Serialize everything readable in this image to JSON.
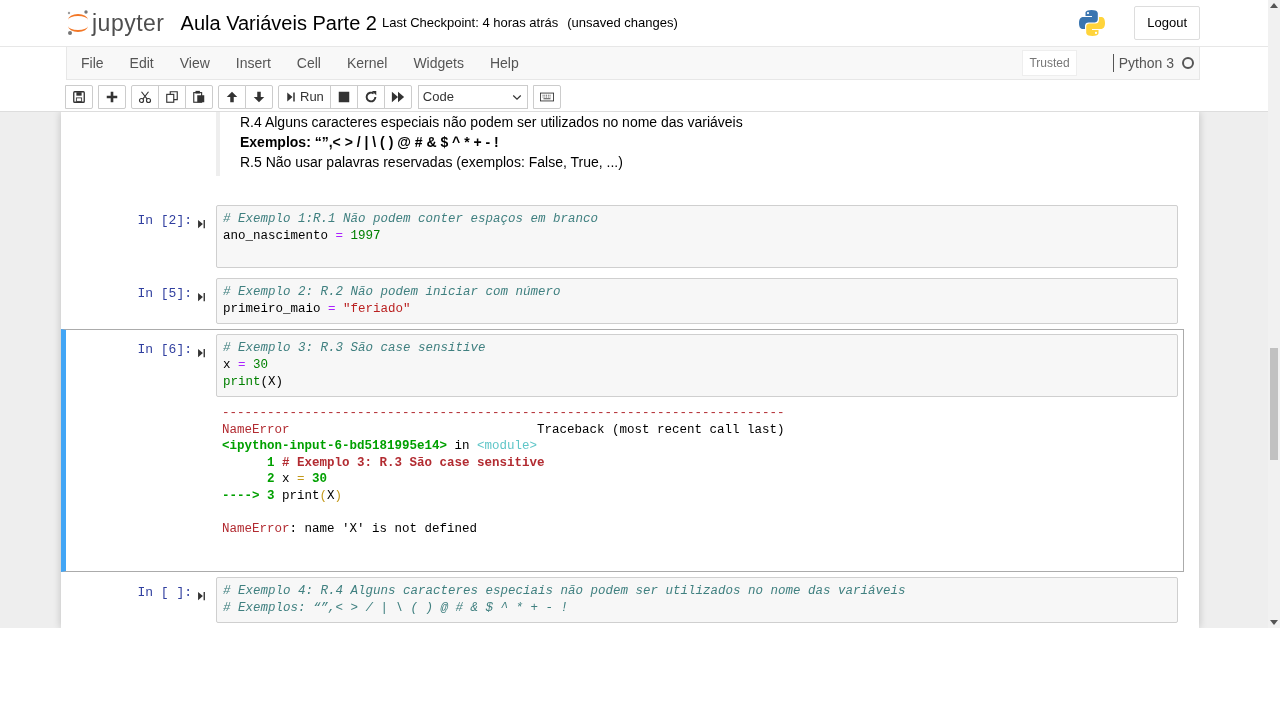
{
  "header": {
    "logo_text": "jupyter",
    "title": "Aula Variáveis Parte 2",
    "checkpoint": "Last Checkpoint: 4 horas atrás",
    "unsaved": "(unsaved changes)",
    "logout": "Logout"
  },
  "menu": [
    "File",
    "Edit",
    "View",
    "Insert",
    "Cell",
    "Kernel",
    "Widgets",
    "Help"
  ],
  "trusted": "Trusted",
  "kernel": {
    "name": "Python 3",
    "idle": true
  },
  "toolbar": [
    [
      {
        "kind": "save"
      }
    ],
    [
      {
        "kind": "add"
      }
    ],
    [
      {
        "kind": "cut"
      },
      {
        "kind": "copy"
      },
      {
        "kind": "paste"
      }
    ],
    [
      {
        "kind": "up"
      },
      {
        "kind": "down"
      }
    ],
    [
      {
        "kind": "run",
        "label": "Run"
      },
      {
        "kind": "stop"
      },
      {
        "kind": "restart"
      },
      {
        "kind": "forward"
      }
    ],
    [
      {
        "kind": "select",
        "value": "Code"
      }
    ],
    [
      {
        "kind": "keyboard"
      }
    ]
  ],
  "cells": [
    {
      "kind": "markdown",
      "lines": [
        {
          "kind": "plain",
          "text": "R.4 Alguns caracteres especiais não podem ser utilizados no nome das variáveis"
        },
        {
          "kind": "bold",
          "text": "Exemplos: “”,< > / | \\ ( ) @ # & $ ^ * + - !"
        },
        {
          "kind": "plain",
          "text": "R.5 Não usar palavras reservadas (exemplos: False, True, ...)"
        }
      ]
    },
    {
      "kind": "code",
      "prompt": "In [2]:",
      "selected": false,
      "input": [
        [
          {
            "kind": "comment",
            "text": "# Exemplo 1:R.1 Não podem conter espaços em branco"
          }
        ],
        [
          {
            "kind": "name",
            "text": "ano_nascimento "
          },
          {
            "kind": "op",
            "text": "="
          },
          {
            "kind": "num",
            "text": " 1997"
          }
        ]
      ]
    },
    {
      "kind": "code",
      "prompt": "In [5]:",
      "selected": false,
      "input": [
        [
          {
            "kind": "comment",
            "text": "# Exemplo 2: R.2 Não podem iniciar com número"
          }
        ],
        [
          {
            "kind": "name",
            "text": "primeiro_maio "
          },
          {
            "kind": "op",
            "text": "="
          },
          {
            "kind": "str",
            "text": " \"feriado\""
          }
        ]
      ]
    },
    {
      "kind": "code",
      "prompt": "In [6]:",
      "selected": true,
      "input": [
        [
          {
            "kind": "comment",
            "text": "# Exemplo 3: R.3 São case sensitive"
          }
        ],
        [
          {
            "kind": "name",
            "text": "x "
          },
          {
            "kind": "op",
            "text": "="
          },
          {
            "kind": "num",
            "text": " 30"
          }
        ],
        [
          {
            "kind": "builtin",
            "text": "print"
          },
          {
            "kind": "name",
            "text": "(X)"
          }
        ]
      ],
      "output": [
        [
          {
            "kind": "red",
            "text": "---------------------------------------------------------------------------"
          }
        ],
        [
          {
            "kind": "red",
            "text": "NameError"
          },
          {
            "kind": "plain",
            "text": "                                 Traceback (most recent call last)"
          }
        ],
        [
          {
            "kind": "green",
            "text": "<ipython-input-6-bd5181995e14>"
          },
          {
            "kind": "plain",
            "text": " in "
          },
          {
            "kind": "cyan",
            "text": "<module>"
          }
        ],
        [
          {
            "kind": "green",
            "text": "      1 "
          },
          {
            "kind": "redbold",
            "text": "# Exemplo 3: R.3 São case sensitive"
          }
        ],
        [
          {
            "kind": "green",
            "text": "      2 "
          },
          {
            "kind": "plain",
            "text": "x "
          },
          {
            "kind": "yellow",
            "text": "="
          },
          {
            "kind": "green",
            "text": " 30"
          }
        ],
        [
          {
            "kind": "green",
            "text": "----> 3 "
          },
          {
            "kind": "plain",
            "text": "print"
          },
          {
            "kind": "yellow",
            "text": "("
          },
          {
            "kind": "plain",
            "text": "X"
          },
          {
            "kind": "yellow",
            "text": ")"
          }
        ],
        [
          {
            "kind": "red",
            "text": "NameError"
          },
          {
            "kind": "plain",
            "text": ": name 'X' is not defined"
          }
        ]
      ]
    },
    {
      "kind": "code",
      "prompt": "In [ ]:",
      "selected": false,
      "input": [
        [
          {
            "kind": "comment",
            "text": "# Exemplo 4: R.4 Alguns caracteres especiais não podem ser utilizados no nome das variáveis"
          }
        ],
        [
          {
            "kind": "comment",
            "text": "# Exemplos: “”,< > / | \\ ( ) @ # & $ ^ * + - !"
          }
        ]
      ]
    }
  ]
}
